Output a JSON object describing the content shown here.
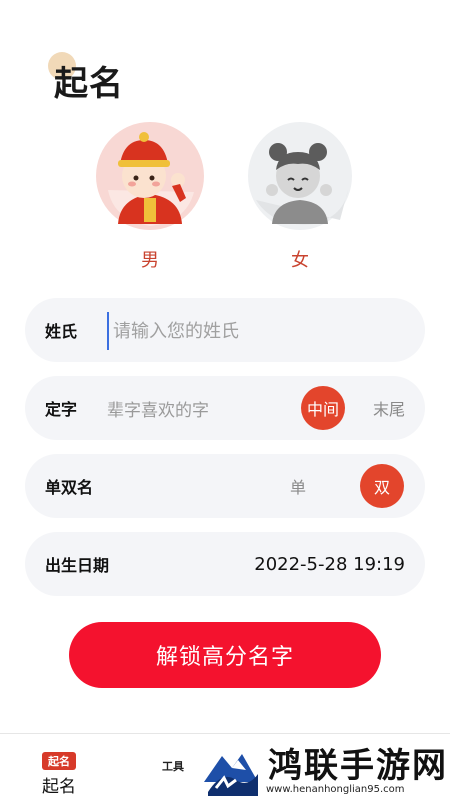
{
  "page_title": "起名",
  "gender": {
    "male_label": "男",
    "female_label": "女",
    "selected": "male"
  },
  "surname": {
    "label": "姓氏",
    "placeholder": "请输入您的姓氏",
    "value": ""
  },
  "fixed_char": {
    "label": "定字",
    "hint": "辈字喜欢的字",
    "options": [
      "中间",
      "末尾"
    ],
    "selected": "中间"
  },
  "name_length": {
    "label": "单双名",
    "options": [
      "单",
      "双"
    ],
    "selected": "双"
  },
  "birth": {
    "label": "出生日期",
    "value": "2022-5-28 19:19"
  },
  "cta_label": "解锁高分名字",
  "tabbar": {
    "active_badge": "起名",
    "active_label": "起名",
    "tools_label": "工具"
  },
  "watermark": {
    "title": "鸿联手游网",
    "url": "www.henanhonglian95.com"
  },
  "colors": {
    "accent": "#e3452c",
    "cta": "#f4122e",
    "card_bg": "#f4f5f8"
  }
}
